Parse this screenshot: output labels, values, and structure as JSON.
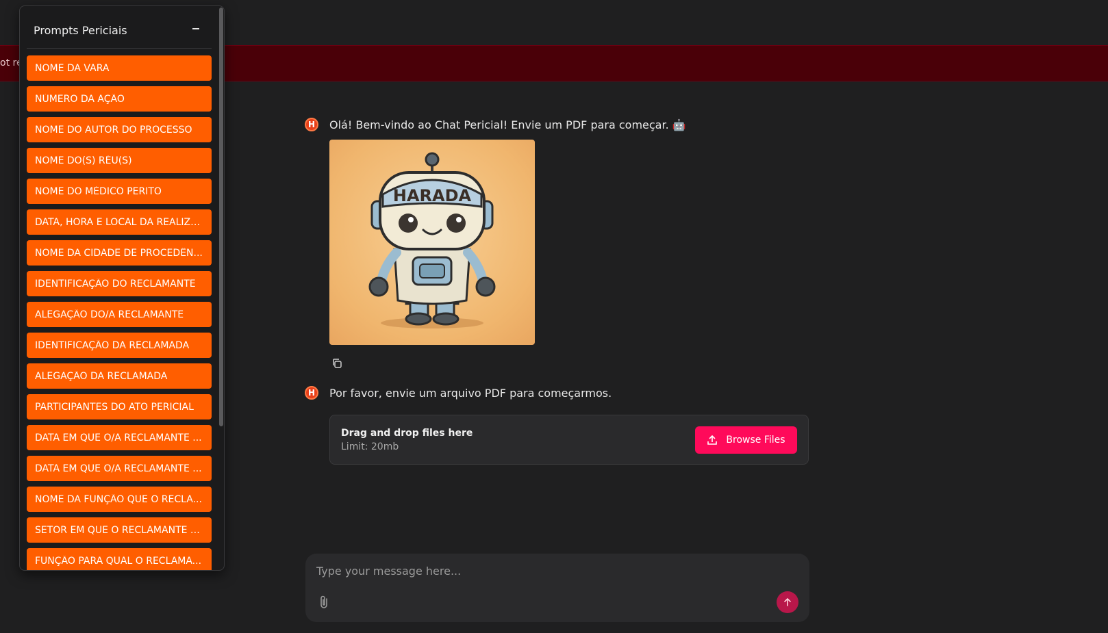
{
  "alert": {
    "text": "ot rea"
  },
  "panel": {
    "title": "Prompts Periciais",
    "items": [
      "NOME DA VARA",
      "NÚMERO DA AÇÃO",
      "NOME DO AUTOR DO PROCESSO",
      "NOME DO(S) RÉU(S)",
      "NOME DO MÉDICO PERITO",
      "DATA, HORA E LOCAL DA REALIZA...",
      "NOME DA CIDADE DE PROCEDÊN...",
      "IDENTIFICAÇÃO DO RECLAMANTE",
      "ALEGAÇÃO DO/A RECLAMANTE",
      "IDENTIFICAÇÃO DA RECLAMADA",
      "ALEGAÇÃO DA RECLAMADA",
      "PARTICIPANTES DO ATO PERICIAL",
      "DATA EM QUE O/A RECLAMANTE ...",
      "DATA EM QUE O/A RECLAMANTE ...",
      "NOME DA FUNÇÃO QUE O RECLA...",
      "SETOR EM QUE O RECLAMANTE T...",
      "FUNÇÃO PARA QUAL O RECLAMA..."
    ]
  },
  "chat": {
    "avatar_letter": "H",
    "welcome": "Olá! Bem-vindo ao Chat Pericial! Envie um PDF para começar. 🤖",
    "image_text": "HARADA",
    "prompt": "Por favor, envie um arquivo PDF para começarmos."
  },
  "upload": {
    "title": "Drag and drop files here",
    "limit": "Limit: 20mb",
    "button": "Browse Files"
  },
  "input": {
    "placeholder": "Type your message here..."
  },
  "colors": {
    "accent_orange": "#ff5e00",
    "accent_pink": "#ff0a5a",
    "background": "#1f1f20"
  }
}
